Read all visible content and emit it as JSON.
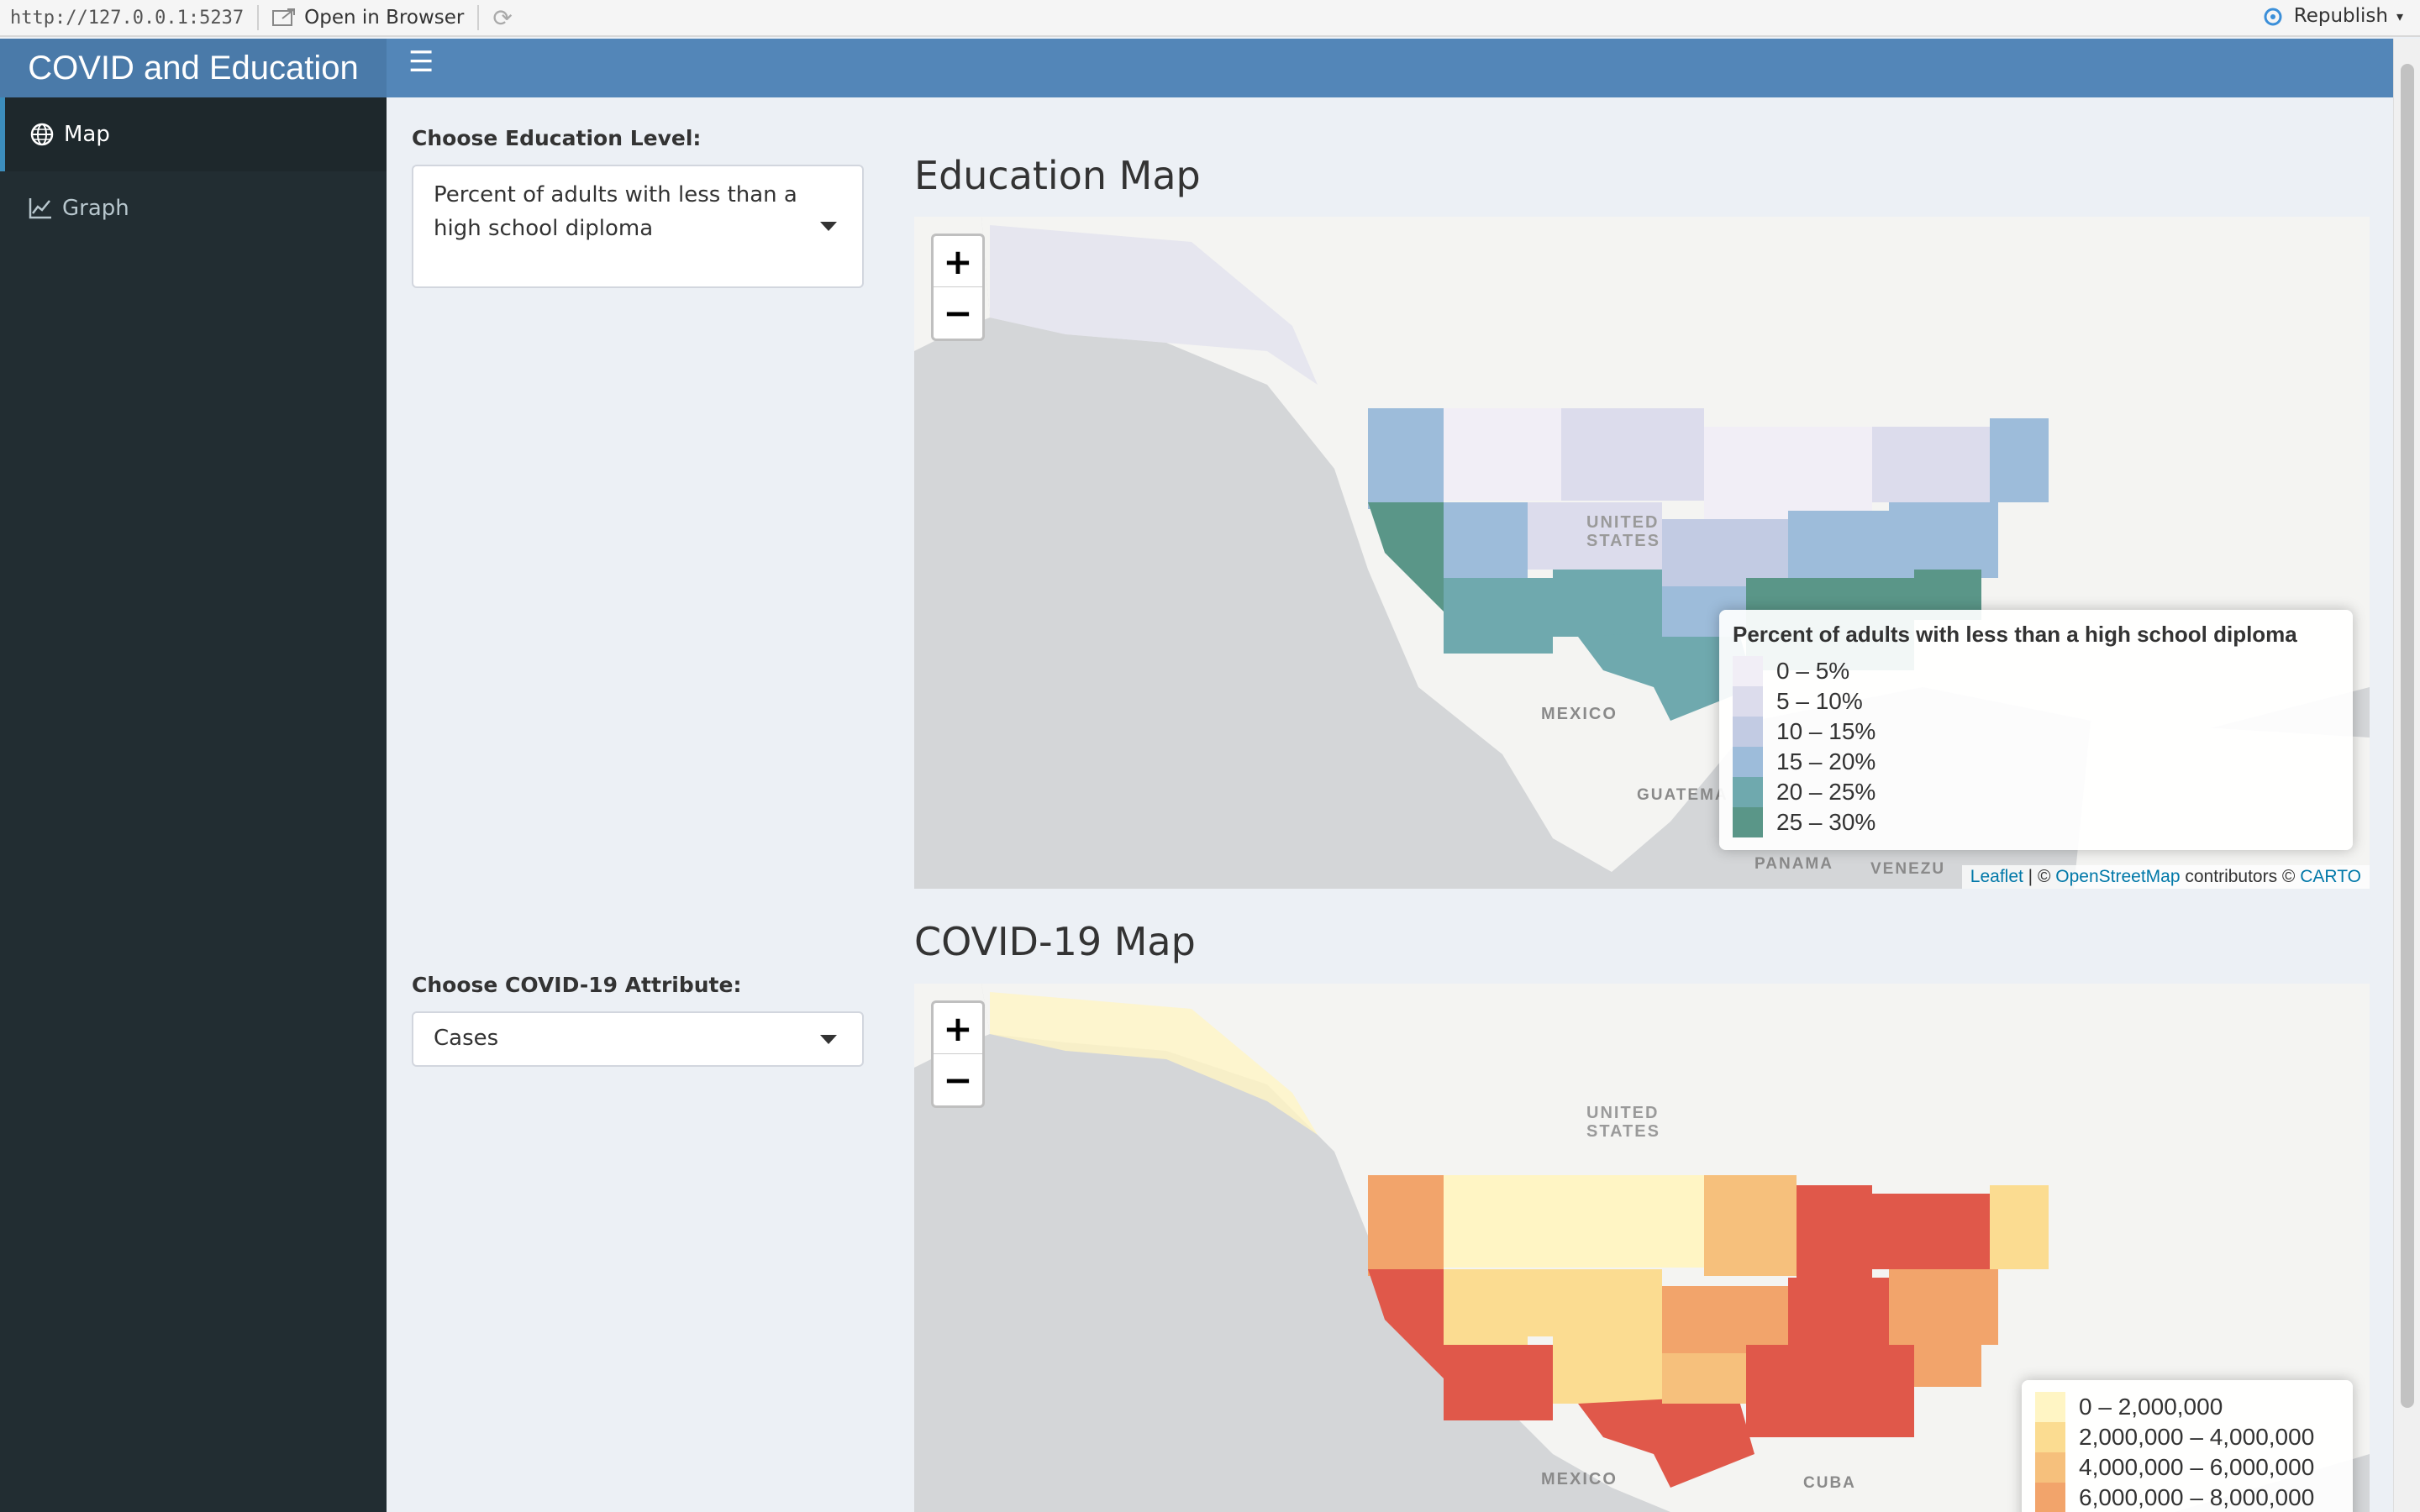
{
  "toolbar": {
    "url": "http://127.0.0.1:5237",
    "open_in_browser": "Open in Browser",
    "republish": "Republish"
  },
  "header": {
    "title": "COVID and Education"
  },
  "sidebar": {
    "items": [
      {
        "label": "Map",
        "icon": "globe-icon",
        "active": true
      },
      {
        "label": "Graph",
        "icon": "line-chart-icon",
        "active": false
      }
    ]
  },
  "education": {
    "control_label": "Choose Education Level:",
    "selected": "Percent of adults with less than a high school diploma",
    "map_title": "Education Map",
    "legend": {
      "title": "Percent of adults with less than a high school diploma",
      "items": [
        {
          "label": "0 – 5%",
          "color": "#f1eef6"
        },
        {
          "label": "5 – 10%",
          "color": "#dcdcec"
        },
        {
          "label": "10 – 15%",
          "color": "#c2cbe3"
        },
        {
          "label": "15 – 20%",
          "color": "#9dbcda"
        },
        {
          "label": "20 – 25%",
          "color": "#6fa9ae"
        },
        {
          "label": "25 – 30%",
          "color": "#5a9688"
        }
      ]
    }
  },
  "covid": {
    "control_label": "Choose COVID-19 Attribute:",
    "selected": "Cases",
    "map_title": "COVID-19 Map",
    "legend": {
      "items": [
        {
          "label": "0 – 2,000,000",
          "color": "#fff5c4"
        },
        {
          "label": "2,000,000 – 4,000,000",
          "color": "#fbdc91"
        },
        {
          "label": "4,000,000 – 6,000,000",
          "color": "#f6c07c"
        },
        {
          "label": "6,000,000 – 8,000,000",
          "color": "#f2a46b"
        }
      ]
    }
  },
  "map_labels": {
    "united": "UNITED",
    "states": "STATES",
    "mexico": "MEXICO",
    "guatemala": "GUATEMA",
    "panama": "PANAMA",
    "venezuela": "VENEZU",
    "cuba": "CUBA"
  },
  "zoom": {
    "in": "+",
    "out": "−"
  },
  "attribution": {
    "leaflet": "Leaflet",
    "sep": " | © ",
    "osm": "OpenStreetMap",
    "contrib": " contributors © ",
    "carto": "CARTO"
  }
}
